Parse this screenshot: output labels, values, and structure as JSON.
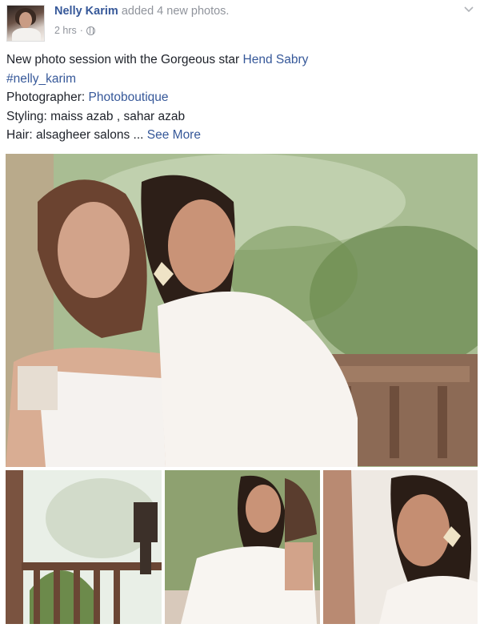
{
  "post": {
    "author": "Nelly Karim",
    "action": "added 4 new photos.",
    "time": "2 hrs",
    "separator": "·",
    "privacy_icon": "globe-icon",
    "menu_icon": "chevron-down-icon",
    "text": {
      "line1_prefix": "New photo session with the Gorgeous star ",
      "line1_link": "Hend Sabry",
      "line2_link": "#nelly_karim",
      "line3_prefix": "Photographer: ",
      "line3_link": "Photoboutique",
      "line4": "Styling: maiss azab , sahar azab",
      "line5": "Hair: alsagheer salons ...",
      "see_more": "See More"
    }
  },
  "colors": {
    "link": "#365899",
    "meta": "#90949c",
    "text": "#1d2129"
  }
}
